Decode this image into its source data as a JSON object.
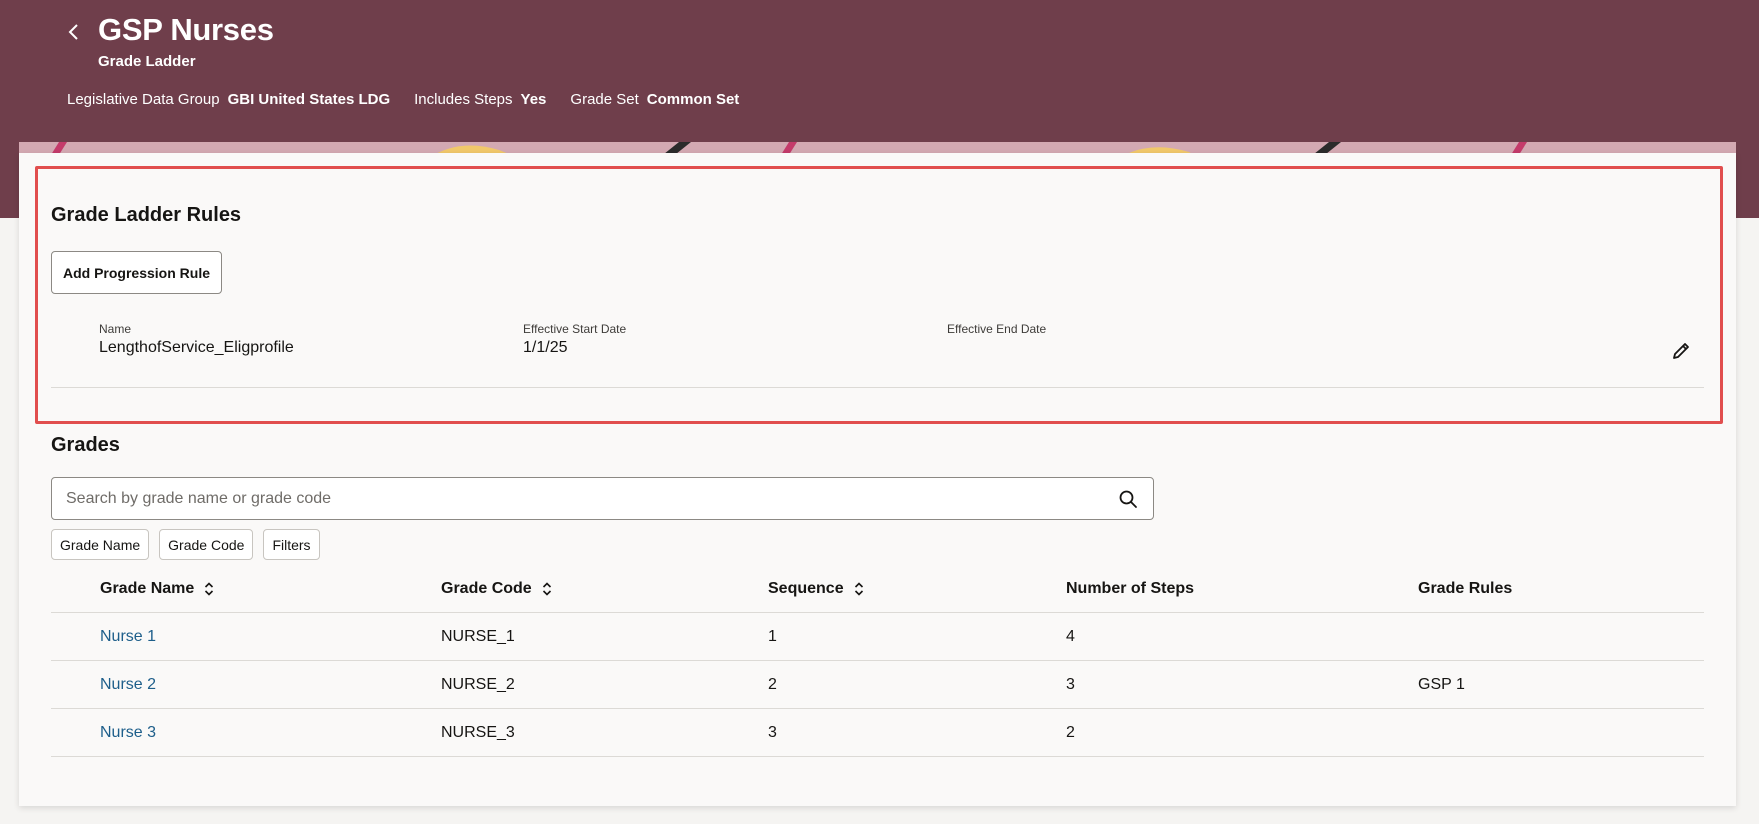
{
  "header": {
    "title": "GSP Nurses",
    "subtitle": "Grade Ladder",
    "meta": [
      {
        "key": "Legislative Data Group",
        "value": "GBI United States LDG"
      },
      {
        "key": "Includes Steps",
        "value": "Yes"
      },
      {
        "key": "Grade Set",
        "value": "Common Set"
      }
    ]
  },
  "rules_section": {
    "title": "Grade Ladder Rules",
    "add_button": "Add Progression Rule",
    "rule": {
      "name_label": "Name",
      "name": "LengthofService_Eligprofile",
      "start_label": "Effective Start Date",
      "start": "1/1/25",
      "end_label": "Effective End Date",
      "end": ""
    }
  },
  "grades_section": {
    "title": "Grades",
    "search_placeholder": "Search by grade name or grade code",
    "chips": [
      "Grade Name",
      "Grade Code",
      "Filters"
    ],
    "columns": [
      "Grade Name",
      "Grade Code",
      "Sequence",
      "Number of Steps",
      "Grade Rules"
    ],
    "rows": [
      {
        "name": "Nurse 1",
        "code": "NURSE_1",
        "sequence": "1",
        "steps": "4",
        "rules": ""
      },
      {
        "name": "Nurse 2",
        "code": "NURSE_2",
        "sequence": "2",
        "steps": "3",
        "rules": "GSP 1"
      },
      {
        "name": "Nurse 3",
        "code": "NURSE_3",
        "sequence": "3",
        "steps": "2",
        "rules": ""
      }
    ]
  },
  "colors": {
    "header_bg": "#6f3e4b",
    "highlight_border": "#e14e4e",
    "link": "#1d5e8a"
  },
  "icons": [
    "back-chevron-icon",
    "pencil-edit-icon",
    "search-icon",
    "sort-updown-icon"
  ]
}
